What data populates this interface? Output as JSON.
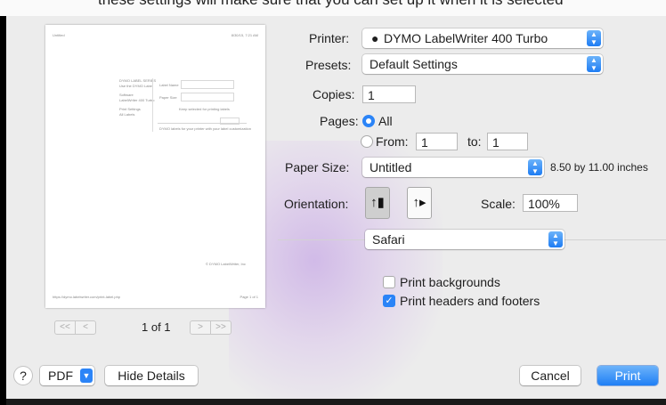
{
  "top_strip": {
    "text": "these settings will make sure that you can set up it when it is selected"
  },
  "preview": {
    "header_left": "Untitled",
    "header_right": "8/30/15, 7:21 AM",
    "footer_left": "https://dymo.labelwriter.com/print-label.php",
    "footer_right": "Page 1 of 1",
    "left_col": [
      "DYMO LABEL SERIES",
      "Use the DYMO Label",
      "Software",
      "LabelWriter 400 Turbo",
      "Print Settings",
      "All Labels"
    ],
    "mid_labels": [
      "Label Name",
      "Paper Size"
    ],
    "checkbox_note": "Keep selected for printing labels",
    "body_note": "DYMO labels for your printer with your label customization",
    "copyright": "© DYMO LabelWriter, Inc"
  },
  "page_nav": {
    "first": "<<",
    "prev": "<",
    "next": ">",
    "last": ">>",
    "count": "1 of 1"
  },
  "printer": {
    "label": "Printer:",
    "value": "DYMO LabelWriter 400 Turbo"
  },
  "presets": {
    "label": "Presets:",
    "value": "Default Settings"
  },
  "copies": {
    "label": "Copies:",
    "value": "1"
  },
  "pages": {
    "label": "Pages:",
    "all_label": "All",
    "from_label": "From:",
    "from_value": "1",
    "to_label": "to:",
    "to_value": "1",
    "selected": "All"
  },
  "paper_size": {
    "label": "Paper Size:",
    "value": "Untitled",
    "dimensions": "8.50 by 11.00 inches"
  },
  "orientation": {
    "label": "Orientation:",
    "selected": "portrait"
  },
  "scale": {
    "label": "Scale:",
    "value": "100%"
  },
  "app_options": {
    "value": "Safari"
  },
  "print_backgrounds": {
    "label": "Print backgrounds",
    "checked": false
  },
  "print_headers_footers": {
    "label": "Print headers and footers",
    "checked": true
  },
  "bottom_bar": {
    "help": "?",
    "pdf": "PDF",
    "hide_details": "Hide Details",
    "cancel": "Cancel",
    "print": "Print"
  },
  "colors": {
    "accent": "#2b84f7",
    "dialog_bg": "#ececec",
    "glow": "#d8b8ee"
  }
}
